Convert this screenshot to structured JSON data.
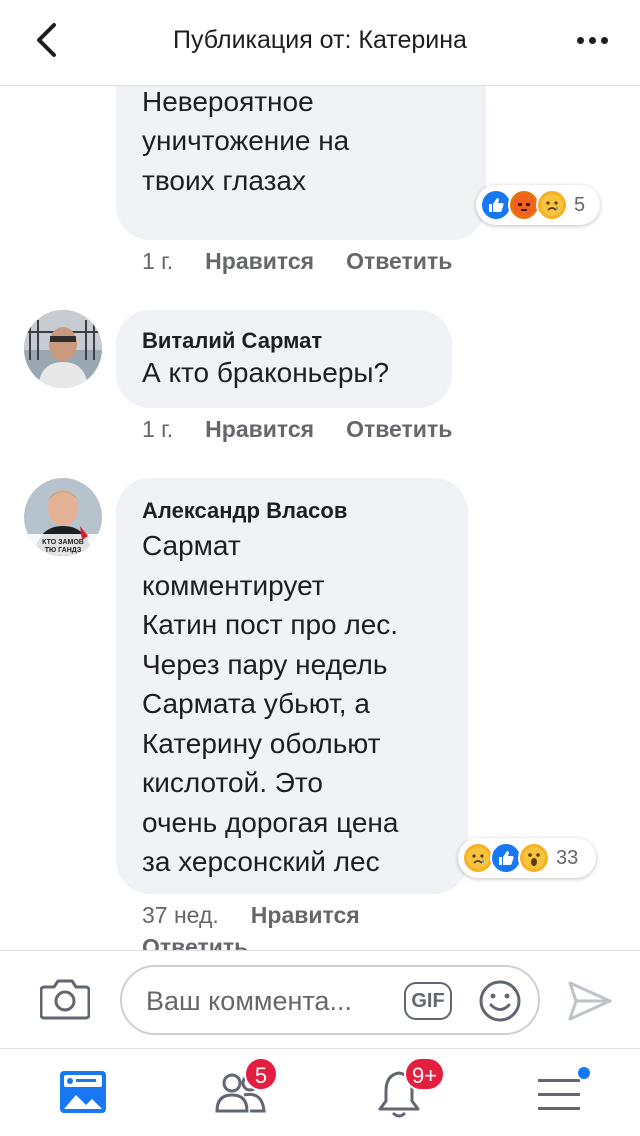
{
  "header": {
    "title": "Публикация от: Катерина"
  },
  "comments": [
    {
      "text": "Черкасской области.\nНевероятное\nуничтожение на\nтвоих глазах",
      "reactions": [
        "like",
        "angry",
        "sad"
      ],
      "reaction_count": "5",
      "time": "1 г.",
      "like_label": "Нравится",
      "reply_label": "Ответить"
    },
    {
      "author": "Виталий Сармат",
      "text": "А кто браконьеры?",
      "time": "1 г.",
      "like_label": "Нравится",
      "reply_label": "Ответить"
    },
    {
      "author": "Александр Власов",
      "text": "Сармат\nкомментирует\nКатин пост про лес.\nЧерез пару недель\nСармата убьют, а\nКатерину обольют\nкислотой. Это\nочень дорогая цена\nза херсонский лес",
      "avatar_caption_1": "КТО ЗАМОВ",
      "avatar_caption_2": "ТЮ ГАНДЗ",
      "reactions": [
        "sad",
        "like",
        "wow"
      ],
      "reaction_count": "33",
      "time": "37 нед.",
      "like_label": "Нравится",
      "reply_label": "Ответить"
    }
  ],
  "composer": {
    "placeholder": "Ваш коммента...",
    "gif_label": "GIF"
  },
  "tabbar": {
    "friends_badge": "5",
    "notifications_badge": "9+"
  },
  "colors": {
    "accent": "#1877f2",
    "badge": "#e41e3f",
    "bubble": "#f0f2f5"
  }
}
